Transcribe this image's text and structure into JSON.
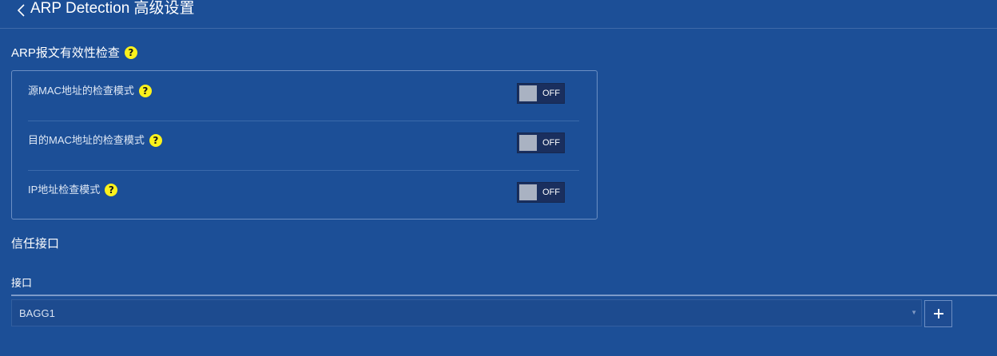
{
  "header": {
    "title": "ARP Detection 高级设置",
    "back_icon": "chevron-left-icon"
  },
  "arp_check": {
    "title": "ARP报文有效性检查",
    "help_glyph": "?",
    "rows": [
      {
        "label": "源MAC地址的检查模式",
        "toggle_state": "OFF",
        "enabled": false
      },
      {
        "label": "目的MAC地址的检查模式",
        "toggle_state": "OFF",
        "enabled": false
      },
      {
        "label": "IP地址检查模式",
        "toggle_state": "OFF",
        "enabled": false
      }
    ]
  },
  "trusted": {
    "title": "信任接口",
    "field_label": "接口",
    "selected_value": "BAGG1",
    "arrow_glyph": "▼",
    "add_icon": "plus-icon"
  },
  "colors": {
    "background": "#1c4f97",
    "toggle_off_track": "#1a2f5e",
    "toggle_knob": "#a9b2c2",
    "help_icon": "#fcf21c"
  }
}
